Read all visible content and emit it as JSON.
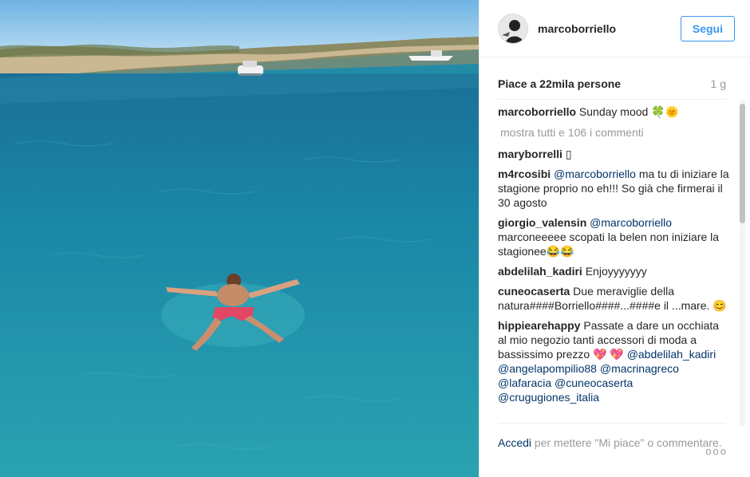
{
  "post": {
    "username": "marcoborriello",
    "follow_label": "Segui",
    "likes": "Piace a 22mila persone",
    "age": "1 g"
  },
  "caption": {
    "user": "marcoborriello",
    "text": "Sunday mood",
    "emoji": "🍀🌞"
  },
  "view_all": "mostra tutti e 106 i commenti",
  "comments": [
    {
      "user": "maryborrelli",
      "parts": [
        {
          "text": "▯"
        }
      ]
    },
    {
      "user": "m4rcosibi",
      "parts": [
        {
          "mention": "@marcoborriello"
        },
        {
          "text": " ma tu di iniziare la stagione proprio no eh!!! So già che firmerai il 30 agosto"
        }
      ]
    },
    {
      "user": "giorgio_valensin",
      "parts": [
        {
          "mention": "@marcoborriello"
        },
        {
          "text": " marconeeeee scopati la belen non iniziare la stagionee😂😂"
        }
      ]
    },
    {
      "user": "abdelilah_kadiri",
      "parts": [
        {
          "text": "Enjoyyyyyyy"
        }
      ]
    },
    {
      "user": "cuneocaserta",
      "parts": [
        {
          "text": "Due meraviglie della natura####Borriello####...####e il ...mare. 😊"
        }
      ]
    },
    {
      "user": "hippiearehappy",
      "parts": [
        {
          "text": "Passate a dare un occhiata al mio negozio tanti accessori di moda a bassissimo prezzo 💖 💖 "
        },
        {
          "mention": "@abdelilah_kadiri"
        },
        {
          "text": " "
        },
        {
          "mention": "@angelapompilio88"
        },
        {
          "text": " "
        },
        {
          "mention": "@macrinagreco"
        },
        {
          "text": " "
        },
        {
          "mention": "@lafaracia"
        },
        {
          "text": " "
        },
        {
          "mention": "@cuneocaserta"
        },
        {
          "text": " "
        },
        {
          "mention": "@crugugiones_italia"
        }
      ]
    }
  ],
  "footer": {
    "login": "Accedi",
    "rest": " per mettere \"Mi piace\" o commentare.",
    "more": "ooo"
  }
}
